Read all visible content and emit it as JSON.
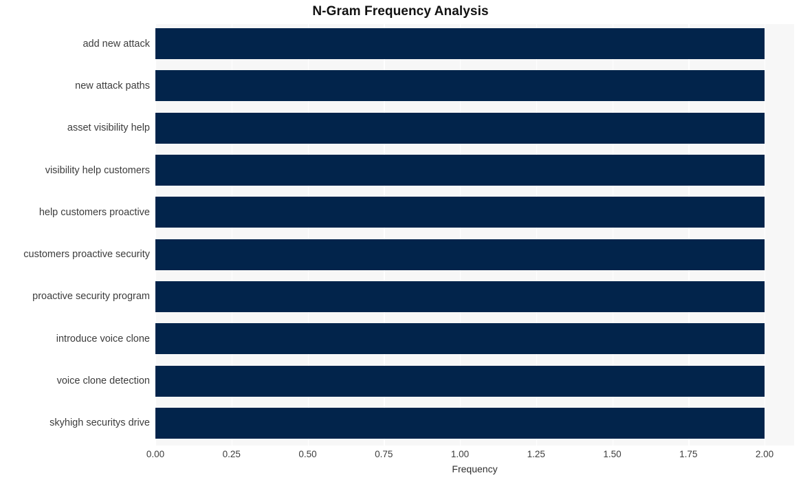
{
  "chart_data": {
    "type": "bar",
    "orientation": "horizontal",
    "title": "N-Gram Frequency Analysis",
    "xlabel": "Frequency",
    "ylabel": "",
    "categories": [
      "add new attack",
      "new attack paths",
      "asset visibility help",
      "visibility help customers",
      "help customers proactive",
      "customers proactive security",
      "proactive security program",
      "introduce voice clone",
      "voice clone detection",
      "skyhigh securitys drive"
    ],
    "values": [
      2,
      2,
      2,
      2,
      2,
      2,
      2,
      2,
      2,
      2
    ],
    "xlim": [
      0.0,
      2.0
    ],
    "xticks": [
      0.0,
      0.25,
      0.5,
      0.75,
      1.0,
      1.25,
      1.5,
      1.75,
      2.0
    ],
    "xtick_labels": [
      "0.00",
      "0.25",
      "0.50",
      "0.75",
      "1.00",
      "1.25",
      "1.50",
      "1.75",
      "2.00"
    ],
    "grid": true,
    "grid_axis": "x",
    "legend": null,
    "bar_color": "#02244b",
    "plot_background": "#f7f7f7",
    "gridline_color": "#ffffff",
    "figure_background": "#ffffff",
    "text_color": "#3c3c3c",
    "title_color": "#111111"
  }
}
